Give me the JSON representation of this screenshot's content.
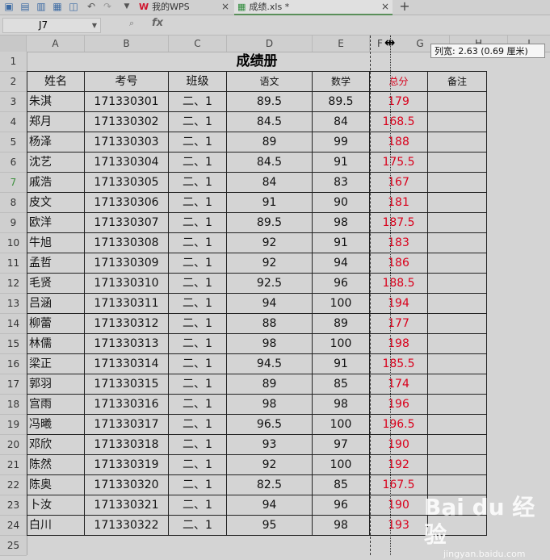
{
  "tabs": [
    {
      "label": "我的WPS",
      "close": "×"
    },
    {
      "label": "成绩.xls *",
      "close": "×"
    }
  ],
  "new_tab": "+",
  "name_box": "J7",
  "fx_label": "fx",
  "columns": [
    "A",
    "B",
    "C",
    "D",
    "E",
    "F",
    "G",
    "H",
    "I"
  ],
  "row_numbers": [
    "1",
    "2",
    "3",
    "4",
    "5",
    "6",
    "7",
    "8",
    "9",
    "10",
    "11",
    "12",
    "13",
    "14",
    "15",
    "16",
    "17",
    "18",
    "19",
    "20",
    "21",
    "22",
    "23",
    "24",
    "25"
  ],
  "active_row": "7",
  "sheet": {
    "title": "成绩册",
    "headers": [
      "姓名",
      "考号",
      "班级",
      "语文",
      "数学",
      "总分",
      "备注"
    ],
    "rows": [
      [
        "朱淇",
        "171330301",
        "二、1",
        "89.5",
        "89.5",
        "179",
        ""
      ],
      [
        "郑月",
        "171330302",
        "二、1",
        "84.5",
        "84",
        "168.5",
        ""
      ],
      [
        "杨泽",
        "171330303",
        "二、1",
        "89",
        "99",
        "188",
        ""
      ],
      [
        "沈艺",
        "171330304",
        "二、1",
        "84.5",
        "91",
        "175.5",
        ""
      ],
      [
        "戚浩",
        "171330305",
        "二、1",
        "84",
        "83",
        "167",
        ""
      ],
      [
        "皮文",
        "171330306",
        "二、1",
        "91",
        "90",
        "181",
        ""
      ],
      [
        "欧洋",
        "171330307",
        "二、1",
        "89.5",
        "98",
        "187.5",
        ""
      ],
      [
        "牛旭",
        "171330308",
        "二、1",
        "92",
        "91",
        "183",
        ""
      ],
      [
        "孟哲",
        "171330309",
        "二、1",
        "92",
        "94",
        "186",
        ""
      ],
      [
        "毛贤",
        "171330310",
        "二、1",
        "92.5",
        "96",
        "188.5",
        ""
      ],
      [
        "吕涵",
        "171330311",
        "二、1",
        "94",
        "100",
        "194",
        ""
      ],
      [
        "柳蕾",
        "171330312",
        "二、1",
        "88",
        "89",
        "177",
        ""
      ],
      [
        "林儒",
        "171330313",
        "二、1",
        "98",
        "100",
        "198",
        ""
      ],
      [
        "梁正",
        "171330314",
        "二、1",
        "94.5",
        "91",
        "185.5",
        ""
      ],
      [
        "郭羽",
        "171330315",
        "二、1",
        "89",
        "85",
        "174",
        ""
      ],
      [
        "宫雨",
        "171330316",
        "二、1",
        "98",
        "98",
        "196",
        ""
      ],
      [
        "冯曦",
        "171330317",
        "二、1",
        "96.5",
        "100",
        "196.5",
        ""
      ],
      [
        "邓欣",
        "171330318",
        "二、1",
        "93",
        "97",
        "190",
        ""
      ],
      [
        "陈然",
        "171330319",
        "二、1",
        "92",
        "100",
        "192",
        ""
      ],
      [
        "陈奥",
        "171330320",
        "二、1",
        "82.5",
        "85",
        "167.5",
        ""
      ],
      [
        "卜汝",
        "171330321",
        "二、1",
        "94",
        "96",
        "190",
        ""
      ],
      [
        "白川",
        "171330322",
        "二、1",
        "95",
        "98",
        "193",
        ""
      ]
    ]
  },
  "tooltip": "列宽: 2.63 (0.69 厘米)",
  "watermark": {
    "logo": "Bai du 经验",
    "url": "jingyan.baidu.com"
  },
  "colors": {
    "total_red": "#d9001b",
    "active_row_green": "#3a8f3a"
  }
}
